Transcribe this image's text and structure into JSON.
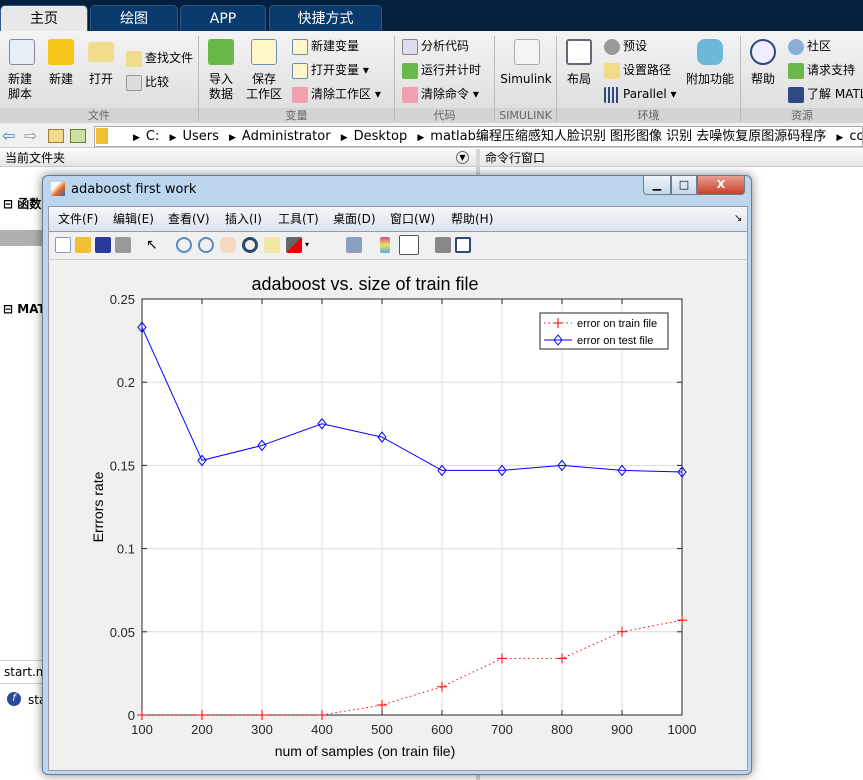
{
  "tabs": [
    "主页",
    "绘图",
    "APP",
    "快捷方式"
  ],
  "ribbon": {
    "new_script": "新建\n脚本",
    "new": "新建",
    "open": "打开",
    "find_files": "查找文件",
    "compare": "比较",
    "import_data": "导入\n数据",
    "save_workspace": "保存\n工作区",
    "new_variable": "新建变量",
    "open_variable": "打开变量",
    "clear_workspace": "清除工作区",
    "analyze_code": "分析代码",
    "run_and_time": "运行并计时",
    "clear_commands": "清除命令",
    "simulink": "Simulink",
    "layout": "布局",
    "preferences": "预设",
    "set_path": "设置路径",
    "parallel": "Parallel",
    "addons": "附加功能",
    "help": "帮助",
    "community": "社区",
    "request_support": "请求支持",
    "learn_matlab": "了解 MATLAB",
    "groups": [
      "文件",
      "变量",
      "代码",
      "SIMULINK",
      "环境",
      "资源"
    ]
  },
  "address": {
    "crumbs": [
      "C:",
      "Users",
      "Administrator",
      "Desktop",
      "matlab编程压缩感知人脸识别 图形图像 识别 去噪恢复原图源码程序",
      "code"
    ]
  },
  "panels": {
    "current_folder": "当前文件夹",
    "command_window": "命令行窗口",
    "functions_label": "函数",
    "matlab_label": "MATLAB",
    "details_file": "start.m",
    "details_item": "start"
  },
  "figure": {
    "title": "adaboost first work",
    "menu": [
      "文件(F)",
      "编辑(E)",
      "查看(V)",
      "插入(I)",
      "工具(T)",
      "桌面(D)",
      "窗口(W)",
      "帮助(H)"
    ]
  },
  "chart_data": {
    "type": "line",
    "title": "adaboost vs. size of train file",
    "xlabel": "num of samples (on train file)",
    "ylabel": "Errrors rate",
    "xlim": [
      100,
      1000
    ],
    "ylim": [
      0,
      0.25
    ],
    "xticks": [
      100,
      200,
      300,
      400,
      500,
      600,
      700,
      800,
      900,
      1000
    ],
    "yticks": [
      0,
      0.05,
      0.1,
      0.15,
      0.2,
      0.25
    ],
    "ytick_labels": [
      "0",
      "0.05",
      "0.1",
      "0.15",
      "0.2",
      "0.25"
    ],
    "grid": true,
    "legend_position": "top-right",
    "x": [
      100,
      200,
      300,
      400,
      500,
      600,
      700,
      800,
      900,
      1000
    ],
    "series": [
      {
        "name": "error on train file",
        "color": "#ff0000",
        "style": "dotted",
        "marker": "plus",
        "values": [
          0,
          0,
          0,
          0,
          0.006,
          0.017,
          0.034,
          0.034,
          0.05,
          0.057
        ]
      },
      {
        "name": "error on test file",
        "color": "#0000ff",
        "style": "solid",
        "marker": "diamond",
        "values": [
          0.233,
          0.153,
          0.162,
          0.175,
          0.167,
          0.147,
          0.147,
          0.15,
          0.147,
          0.146
        ]
      }
    ]
  }
}
